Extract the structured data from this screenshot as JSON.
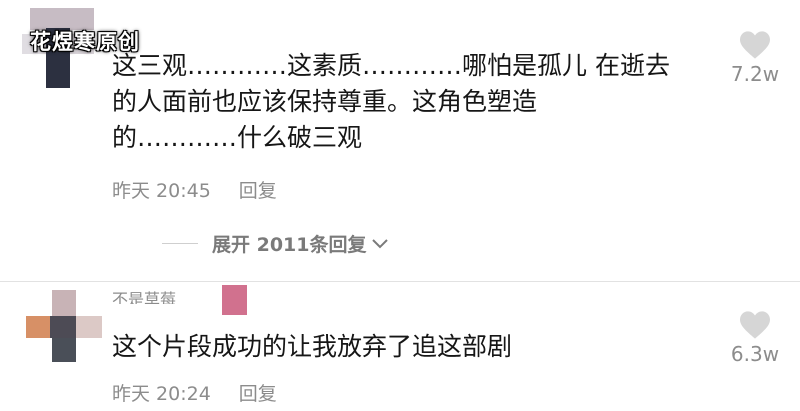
{
  "watermark": "花煜寒原创",
  "comment1": {
    "text_lines": [
      "这三观…………这素质…………哪怕是孤儿 在逝去",
      "的人面前也应该保持尊重。这角色塑造",
      "的…………什么破三观"
    ],
    "time": "昨天 20:45",
    "reply_label": "回复",
    "like_count": "7.2w",
    "like_icon": "heart-icon"
  },
  "expand_replies": {
    "label": "展开 2011条回复",
    "icon": "chevron-down-icon"
  },
  "comment2": {
    "username": "不是草莓",
    "text": "这个片段成功的让我放弃了追这部剧",
    "time": "昨天 20:24",
    "reply_label": "回复",
    "like_count": "6.3w",
    "like_icon": "heart-icon"
  },
  "colors": {
    "text": "#161616",
    "meta": "#8c8c8c",
    "heart": "#d6d6d6"
  }
}
